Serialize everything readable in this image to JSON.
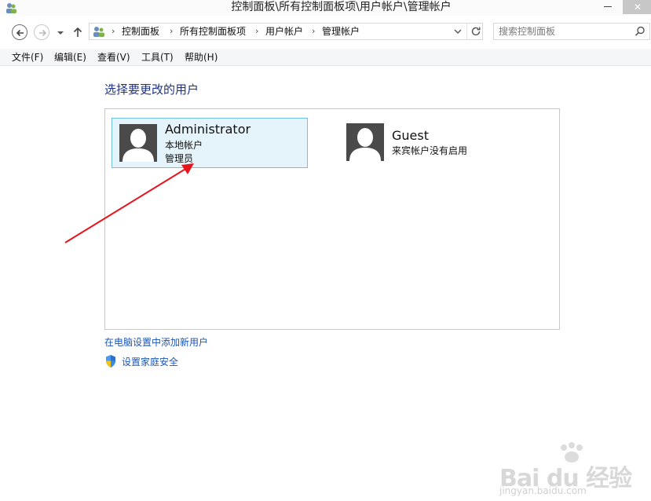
{
  "window": {
    "title": "控制面板\\所有控制面板项\\用户帐户\\管理帐户",
    "app_icon": "users-control-panel-icon",
    "minimize_icon": "minimize-icon",
    "close_icon": "close-icon"
  },
  "navigation": {
    "back_icon": "arrow-left-icon",
    "forward_icon": "arrow-right-icon",
    "recent_icon": "chevron-down-icon",
    "up_icon": "arrow-up-icon"
  },
  "address_bar": {
    "icon": "users-control-panel-icon",
    "separator": "›",
    "breadcrumbs": [
      "控制面板",
      "所有控制面板项",
      "用户帐户",
      "管理帐户"
    ],
    "dropdown_icon": "chevron-down-icon",
    "refresh_icon": "refresh-icon"
  },
  "search": {
    "placeholder": "搜索控制面板",
    "icon": "search-icon"
  },
  "menu": {
    "items": [
      "文件(F)",
      "编辑(E)",
      "查看(V)",
      "工具(T)",
      "帮助(H)"
    ]
  },
  "main": {
    "heading": "选择要更改的用户",
    "users": [
      {
        "name": "Administrator",
        "type": "本地帐户",
        "role": "管理员",
        "selected": true
      },
      {
        "name": "Guest",
        "status": "来宾帐户没有启用",
        "selected": false
      }
    ],
    "links": {
      "add_user": "在电脑设置中添加新用户",
      "family_safety": "设置家庭安全"
    }
  },
  "colors": {
    "heading": "#1e3287",
    "link": "#1e56b4",
    "selection_fill": "#e5f3fb",
    "selection_border": "#70c0e7",
    "annotation": "#e8141c"
  },
  "watermark": {
    "text": "Bai du 经验",
    "sub": "jingyan.baidu.com"
  }
}
